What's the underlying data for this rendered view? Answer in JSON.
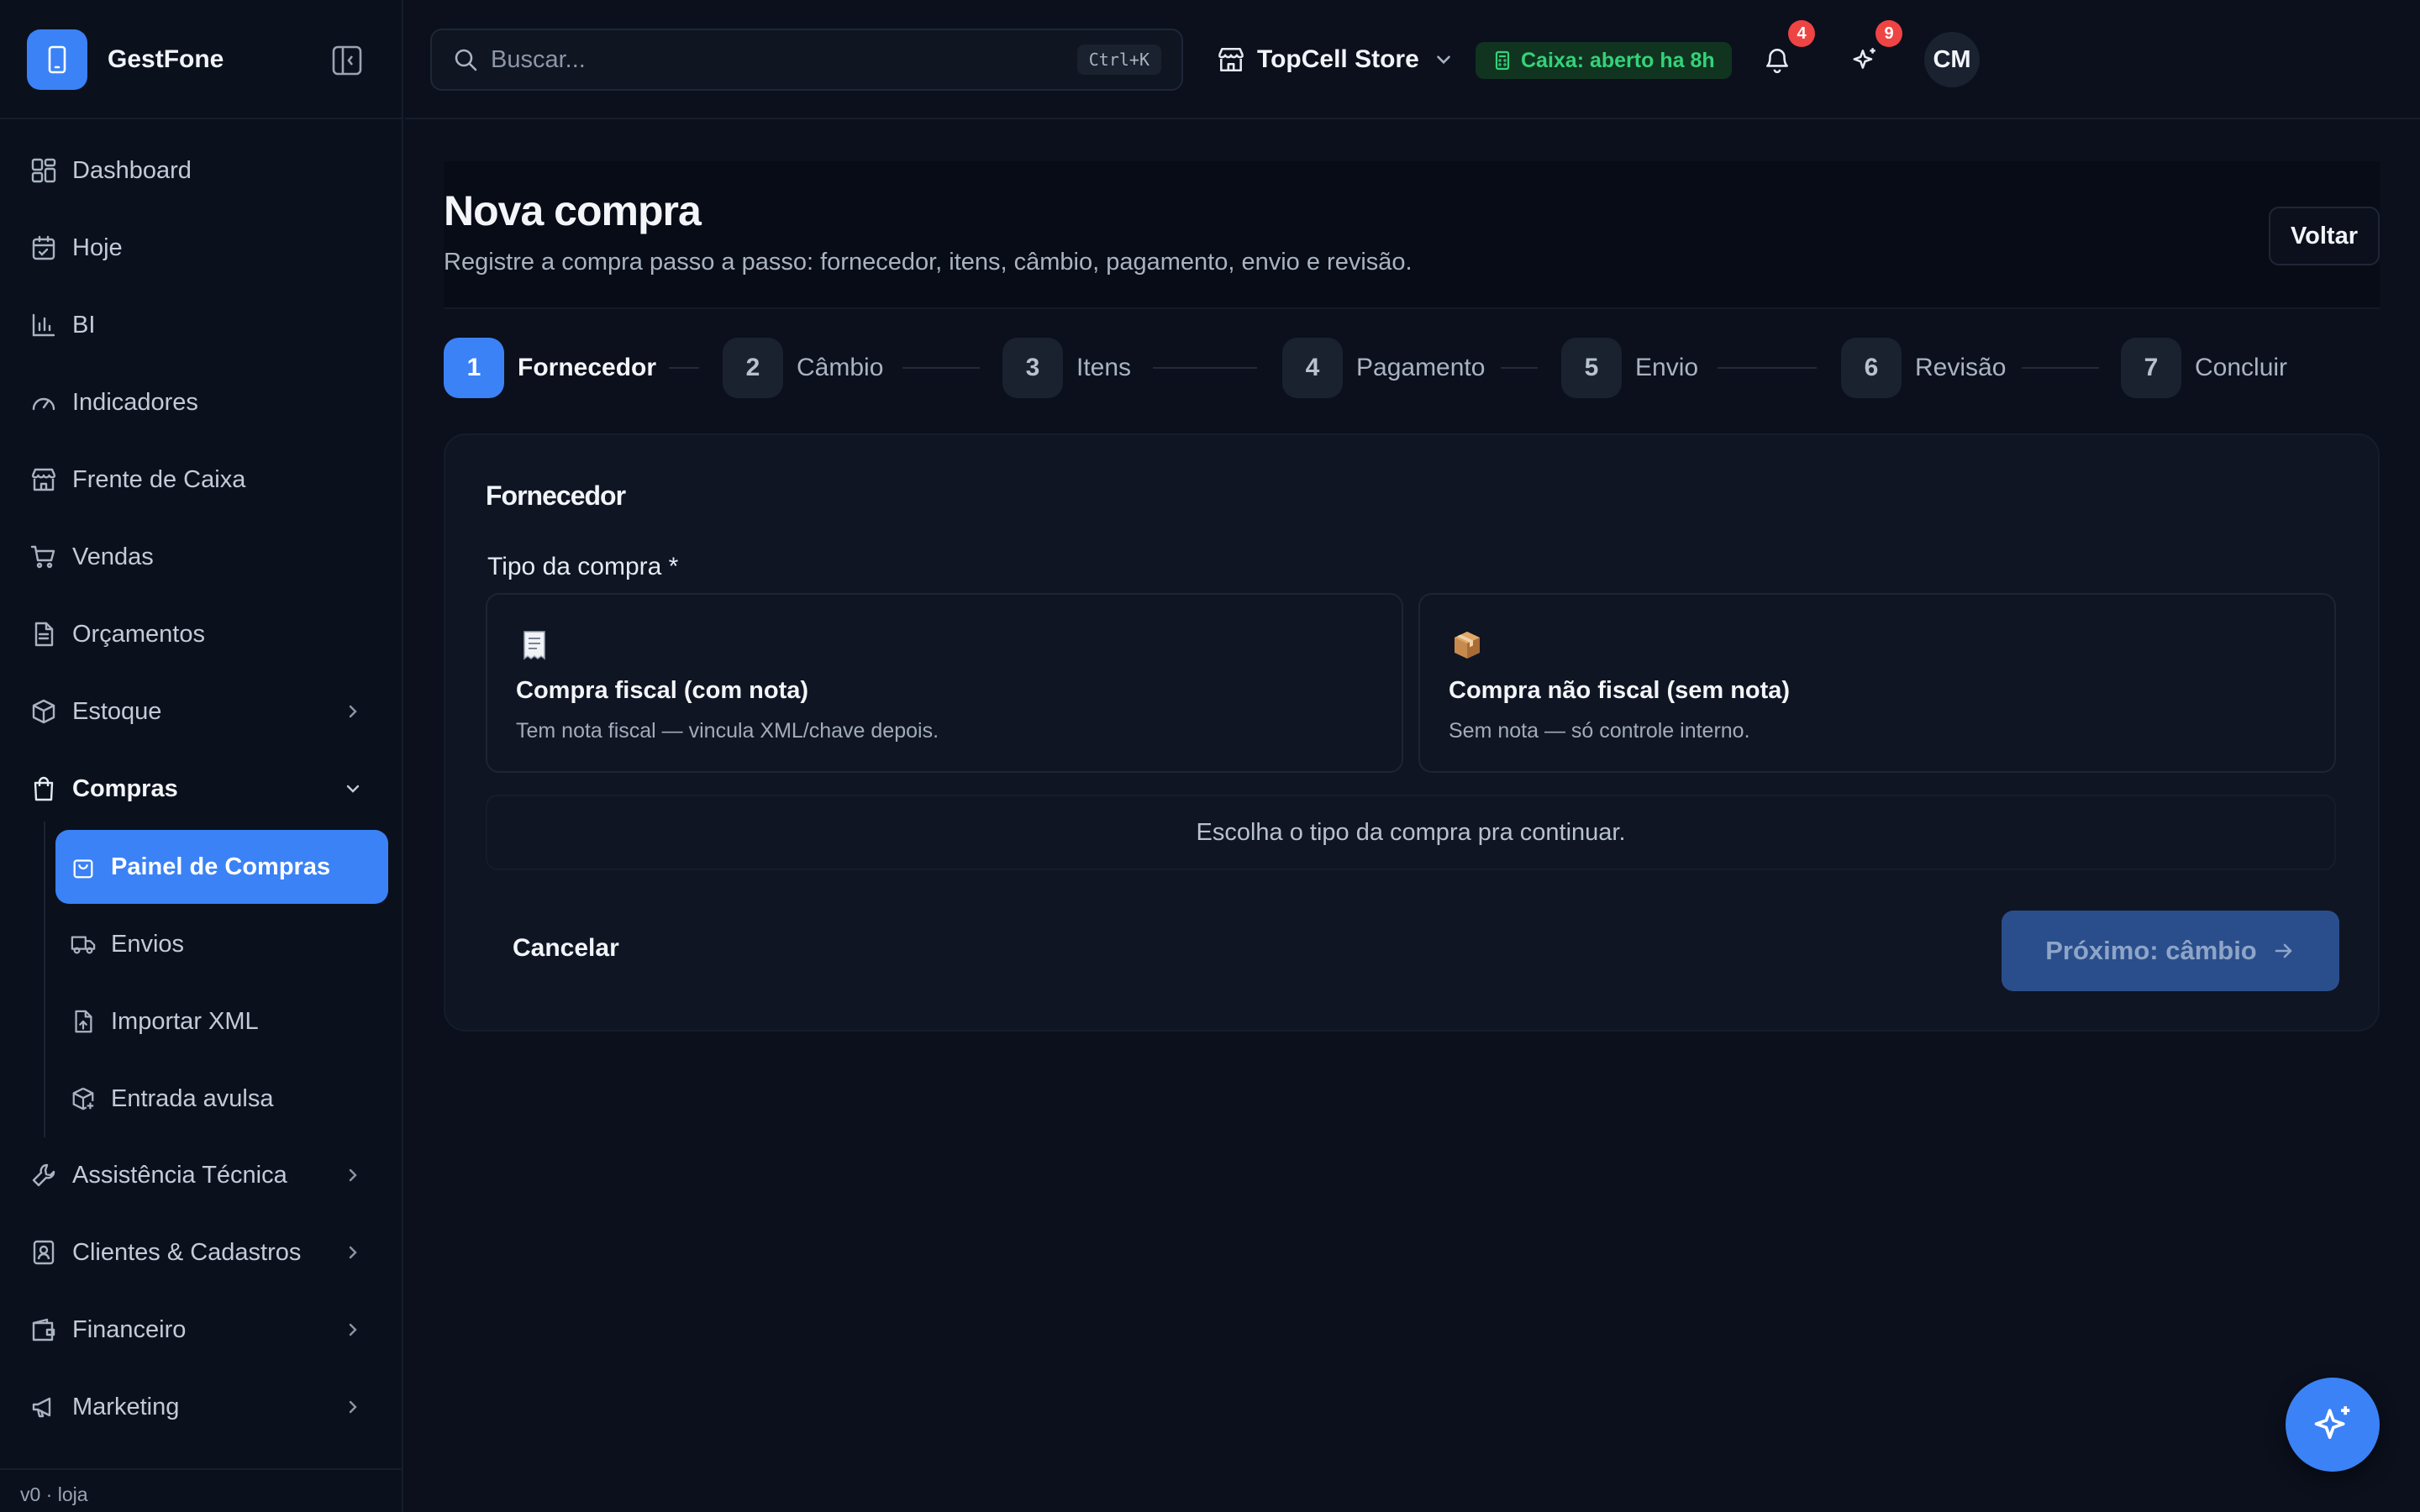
{
  "app": {
    "name": "GestFone",
    "version": "v0 · loja"
  },
  "sidebar": {
    "items": [
      {
        "label": "Dashboard",
        "icon": "dashboard-icon"
      },
      {
        "label": "Hoje",
        "icon": "calendar-check-icon"
      },
      {
        "label": "BI",
        "icon": "bar-chart-icon"
      },
      {
        "label": "Indicadores",
        "icon": "gauge-icon"
      },
      {
        "label": "Frente de Caixa",
        "icon": "store-icon"
      },
      {
        "label": "Vendas",
        "icon": "cart-icon"
      },
      {
        "label": "Orçamentos",
        "icon": "document-icon"
      },
      {
        "label": "Estoque",
        "icon": "package-icon"
      },
      {
        "label": "Compras",
        "icon": "shopping-bag-icon"
      },
      {
        "label": "Assistência Técnica",
        "icon": "wrench-icon"
      },
      {
        "label": "Clientes & Cadastros",
        "icon": "contact-icon"
      },
      {
        "label": "Financeiro",
        "icon": "wallet-icon"
      },
      {
        "label": "Marketing",
        "icon": "megaphone-icon"
      }
    ],
    "compras_sub": [
      {
        "label": "Painel de Compras",
        "icon": "shopping-bag-icon",
        "active": true
      },
      {
        "label": "Envios",
        "icon": "truck-icon"
      },
      {
        "label": "Importar XML",
        "icon": "file-upload-icon"
      },
      {
        "label": "Entrada avulsa",
        "icon": "package-plus-icon"
      }
    ]
  },
  "topbar": {
    "search_placeholder": "Buscar...",
    "search_shortcut": "Ctrl+K",
    "store": "TopCell Store",
    "caixa_status": "Caixa: aberto ha 8h",
    "notifications_count": "4",
    "ai_count": "9",
    "avatar_initials": "CM"
  },
  "page": {
    "title": "Nova compra",
    "subtitle": "Registre a compra passo a passo: fornecedor, itens, câmbio, pagamento, envio e revisão.",
    "back_label": "Voltar"
  },
  "steps": [
    {
      "num": "1",
      "label": "Fornecedor",
      "active": true
    },
    {
      "num": "2",
      "label": "Câmbio"
    },
    {
      "num": "3",
      "label": "Itens"
    },
    {
      "num": "4",
      "label": "Pagamento"
    },
    {
      "num": "5",
      "label": "Envio"
    },
    {
      "num": "6",
      "label": "Revisão"
    },
    {
      "num": "7",
      "label": "Concluir"
    }
  ],
  "form": {
    "section_title": "Fornecedor",
    "type_label": "Tipo da compra *",
    "options": [
      {
        "icon": "receipt-icon",
        "title": "Compra fiscal (com nota)",
        "desc": "Tem nota fiscal — vincula XML/chave depois."
      },
      {
        "icon": "box-icon",
        "title": "Compra não fiscal (sem nota)",
        "desc": "Sem nota — só controle interno."
      }
    ],
    "hint": "Escolha o tipo da compra pra continuar.",
    "cancel_label": "Cancelar",
    "next_label": "Próximo: câmbio"
  },
  "colors": {
    "accent": "#3b82f6",
    "background": "#0b101c",
    "success": "#34d27a",
    "danger": "#ef4444"
  }
}
